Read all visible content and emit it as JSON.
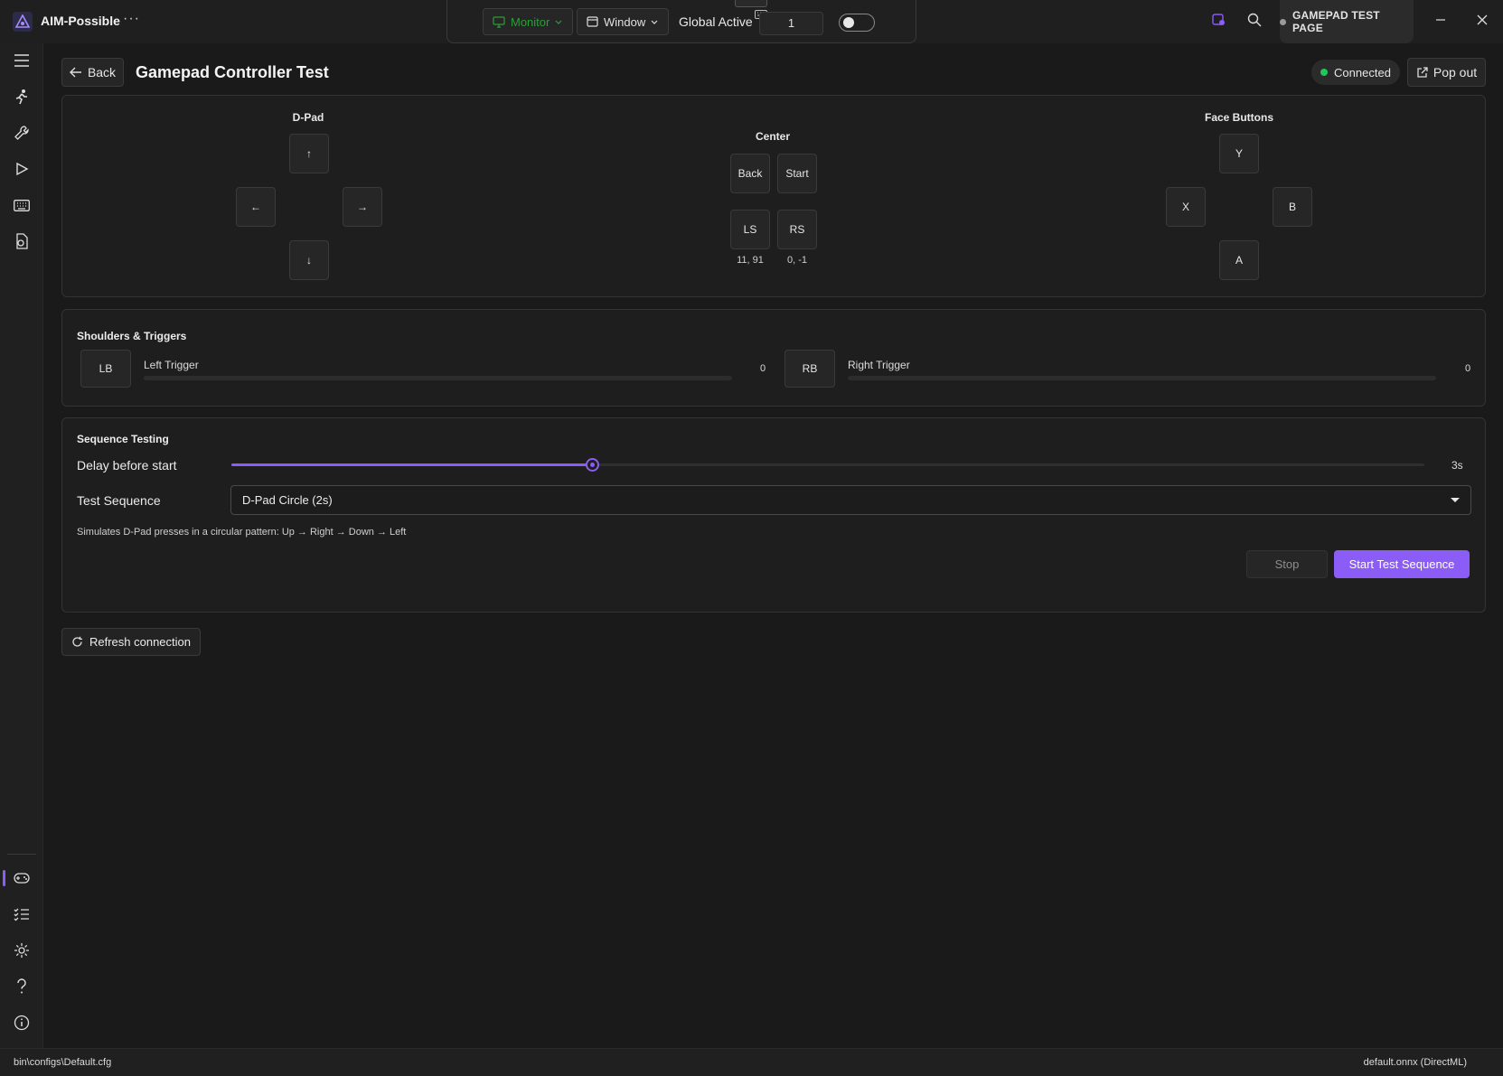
{
  "app": {
    "name": "AIM-Possible"
  },
  "toolbar": {
    "monitor_label": "Monitor",
    "window_label": "Window",
    "global_active_label": "Global Active",
    "global_active_value": "1",
    "toggle_on": false
  },
  "page_pill": "GAMEPAD TEST PAGE",
  "header": {
    "back_label": "Back",
    "title": "Gamepad Controller Test",
    "status": "Connected",
    "popout_label": "Pop out"
  },
  "dpad": {
    "title": "D-Pad",
    "up": "↑",
    "left": "←",
    "right": "→",
    "down": "↓"
  },
  "center": {
    "title": "Center",
    "back": "Back",
    "start": "Start",
    "ls": "LS",
    "rs": "RS",
    "ls_value": "11, 91",
    "rs_value": "0, -1"
  },
  "face": {
    "title": "Face Buttons",
    "y": "Y",
    "x": "X",
    "b": "B",
    "a": "A"
  },
  "shoulders": {
    "title": "Shoulders & Triggers",
    "lb": "LB",
    "rb": "RB",
    "left_trigger_label": "Left Trigger",
    "right_trigger_label": "Right Trigger",
    "left_trigger_value": "0",
    "right_trigger_value": "0",
    "left_trigger_fraction": 0,
    "right_trigger_fraction": 0
  },
  "sequence": {
    "title": "Sequence Testing",
    "delay_label": "Delay before start",
    "delay_fraction": 0.302,
    "delay_value": "3s",
    "test_label": "Test Sequence",
    "test_value": "D-Pad Circle (2s)",
    "description": "Simulates D-Pad presses in a circular pattern: Up → Right → Down → Left",
    "stop_label": "Stop",
    "start_label": "Start Test Sequence"
  },
  "refresh_label": "Refresh connection",
  "statusbar": {
    "config_path": "bin\\configs\\Default.cfg",
    "model": "default.onnx (DirectML)"
  },
  "colors": {
    "accent": "#8b5cf6",
    "connected": "#22c55e",
    "monitor": "#2e9c3a"
  }
}
